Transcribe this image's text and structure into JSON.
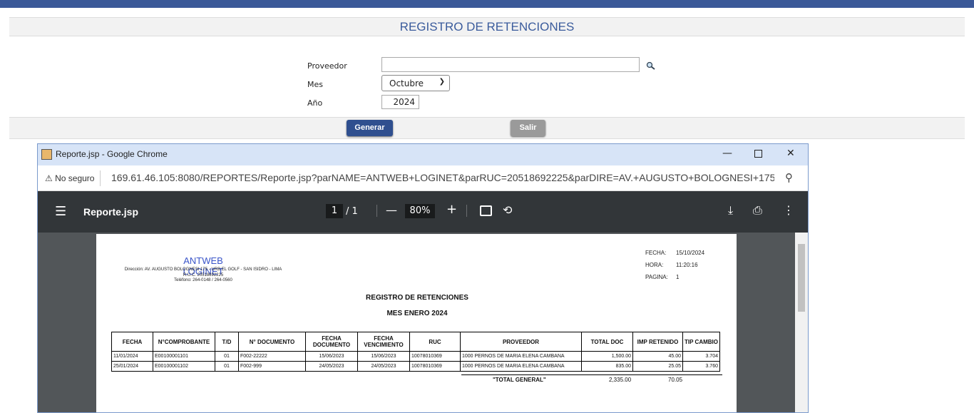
{
  "form": {
    "title": "REGISTRO DE RETENCIONES",
    "proveedor_label": "Proveedor",
    "proveedor_value": "",
    "mes_label": "Mes",
    "mes_value": "Octubre",
    "anio_label": "Año",
    "anio_value": "2024",
    "generar_label": "Generar",
    "salir_label": "Salir"
  },
  "window": {
    "title": "Reporte.jsp - Google Chrome",
    "security": "No seguro",
    "url": "169.61.46.105:8080/REPORTES/Reporte.jsp?parNAME=ANTWEB+LOGINET&parRUC=20518692225&parDIRE=AV.+AUGUSTO+BOLOGNESI+175+-+U..."
  },
  "pdf": {
    "filename": "Reporte.jsp",
    "page_current": "1",
    "page_total": "/  1",
    "zoom": "80%"
  },
  "report": {
    "company": "ANTWEB LOGINET",
    "direccion": "Dirección: AV. AUGUSTO BOLOGNESI 175 - URB EL GOLF - SAN ISIDRO - LIMA",
    "ruc": "R.U.C. 20518692225",
    "telefono": "Teléfono: 264-0148 / 264-0560",
    "fecha_label": "FECHA:",
    "fecha_value": "15/10/2024",
    "hora_label": "HORA:",
    "hora_value": "11:20:16",
    "pagina_label": "PAGINA:",
    "pagina_value": "1",
    "title": "REGISTRO DE RETENCIONES",
    "subtitle": "MES ENERO 2024",
    "headers": [
      "FECHA",
      "N°COMPROBANTE",
      "T/D",
      "N° DOCUMENTO",
      "FECHA DOCUMENTO",
      "FECHA VENCIMIENTO",
      "RUC",
      "PROVEEDOR",
      "TOTAL DOC",
      "IMP RETENIDO",
      "TIP CAMBIO"
    ],
    "rows": [
      [
        "11/01/2024",
        "E00100001101",
        "01",
        "F002-22222",
        "15/06/2023",
        "15/06/2023",
        "10078010369",
        "1000 PERNOS DE MARIA ELENA CAMBANA",
        "1,500.00",
        "45.00",
        "3.704"
      ],
      [
        "25/01/2024",
        "E00100001102",
        "01",
        "F002-999",
        "24/05/2023",
        "24/05/2023",
        "10078010369",
        "1000 PERNOS DE MARIA ELENA CAMBANA",
        "835.00",
        "25.05",
        "3.760"
      ]
    ],
    "total_label": "\"TOTAL GENERAL\"",
    "total_doc": "2,335.00",
    "total_ret": "70.05"
  }
}
